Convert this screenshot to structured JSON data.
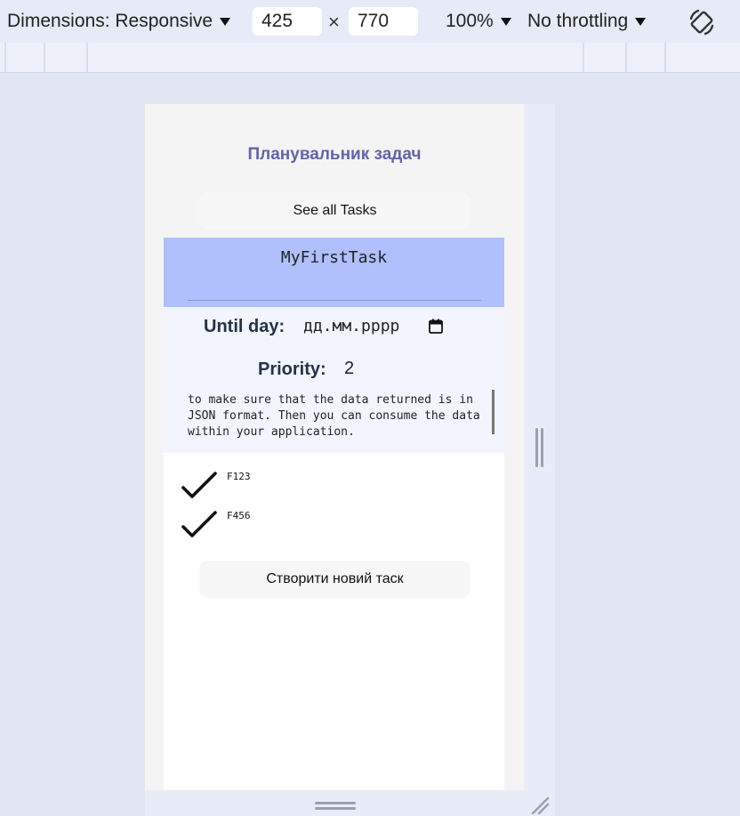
{
  "devtools": {
    "dimensions_label": "Dimensions: Responsive",
    "width_value": "425",
    "times_sign": "×",
    "height_value": "770",
    "zoom_label": "100%",
    "throttling_label": "No throttling"
  },
  "app": {
    "title": "Планувальник задач",
    "see_all_label": "See all Tasks",
    "task_name": "MyFirstTask",
    "until_label": "Until day:",
    "date_placeholder": "дд.мм.рррр",
    "priority_label": "Priority:",
    "priority_value": "2",
    "description": "to make sure that the data returned is in JSON format. Then you can consume the data within your application.",
    "checklist": [
      {
        "label": "F123",
        "checked": true
      },
      {
        "label": "F456",
        "checked": true
      }
    ],
    "create_label": "Створити новий таск"
  },
  "colors": {
    "title": "#6264a7",
    "name_area": "#b0c0fd",
    "detail_area": "#f2f5fe"
  }
}
